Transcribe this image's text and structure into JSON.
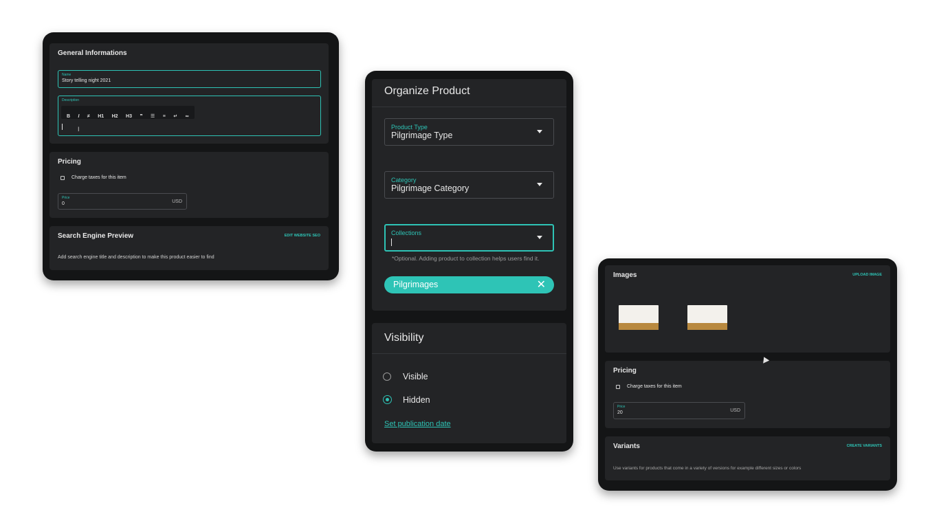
{
  "general": {
    "title": "General Informations",
    "name_label": "Name",
    "name_value": "Story telling night 2021",
    "description_label": "Description",
    "toolbar": [
      "B",
      "I",
      "≠",
      "H1",
      "H2",
      "H3",
      "❞",
      "☰",
      "≡",
      "↵",
      "∞"
    ]
  },
  "pricing_left": {
    "title": "Pricing",
    "charge_taxes": "Charge taxes for this item",
    "price_label": "Price",
    "price_value": "0",
    "currency": "USD"
  },
  "seo": {
    "title": "Search Engine Preview",
    "edit_link": "EDIT WEBSITE SEO",
    "description": "Add search engine title and description to make this product easier to find"
  },
  "organize": {
    "title": "Organize Product",
    "product_type_label": "Product Type",
    "product_type_value": "Pilgrimage Type",
    "category_label": "Category",
    "category_value": "Pilgrimage Category",
    "collections_label": "Collections",
    "collections_help": "*Optional. Adding product to collection helps users find it.",
    "chip": "Pilgrimages"
  },
  "visibility": {
    "title": "Visibility",
    "option_visible": "Visible",
    "option_hidden": "Hidden",
    "selected": "Hidden",
    "set_date_link": "Set publication date"
  },
  "images": {
    "title": "Images",
    "upload_link": "UPLOAD IMAGE"
  },
  "pricing_right": {
    "title": "Pricing",
    "charge_taxes": "Charge taxes for this item",
    "price_label": "Price",
    "price_value": "20",
    "currency": "USD"
  },
  "variants": {
    "title": "Variants",
    "create_link": "CREATE VARIANTS",
    "description": "Use variants for products that come in a variety of versions for example different sizes or colors"
  },
  "colors": {
    "accent": "#2ec4b6",
    "frame": "#141516",
    "card": "#232426"
  }
}
